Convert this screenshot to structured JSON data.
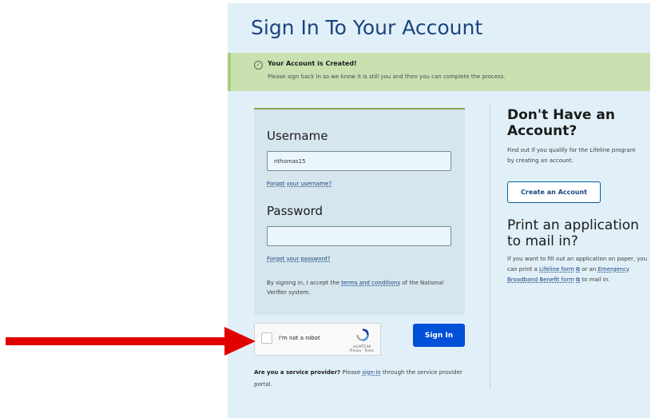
{
  "page": {
    "title": "Sign In To Your Account"
  },
  "alert": {
    "title": "Your Account is Created!",
    "body": "Please sign back in so we know it is still you and then you can complete the process."
  },
  "login": {
    "username_label": "Username",
    "username_value": "nthomas15",
    "forgot_username": "Forgot your username?",
    "password_label": "Password",
    "password_value": "",
    "forgot_password": "Forgot your password?",
    "agree_prefix": "By signing in, I accept the ",
    "agree_link": "terms and conditions",
    "agree_suffix": " of the National Verifier system."
  },
  "captcha": {
    "label": "I'm not a robot",
    "brand": "reCAPTCHA",
    "terms": "Privacy - Terms"
  },
  "signin_button": "Sign In",
  "provider": {
    "bold": "Are you a service provider?",
    "prefix": " Please ",
    "link": "sign-in",
    "suffix": " through the service provider portal."
  },
  "sidebar": {
    "heading1": "Don't Have an Account?",
    "text1": "Find out if you qualify for the Lifeline program by creating an account.",
    "create_button": "Create an Account",
    "heading2": "Print an application to mail in?",
    "text2_prefix": "If you want to fill out an application on paper, you can print a ",
    "link1": "Lifeline form",
    "text2_mid": " or an ",
    "link2": "Emergency Broadband Benefit form",
    "text2_suffix": " to mail in."
  },
  "colors": {
    "arrow": "#e00000",
    "primary": "#0050d8",
    "alert_bg": "#c9e1b1"
  }
}
